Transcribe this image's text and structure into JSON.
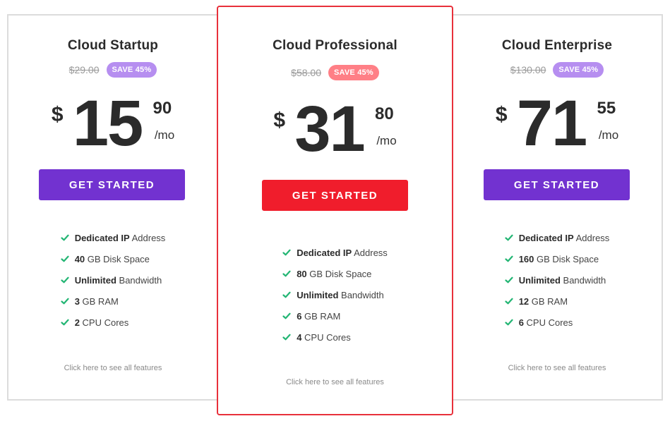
{
  "colors": {
    "purple_button": "#7232d0",
    "red_button": "#f01d2c",
    "featured_border": "#e8303b",
    "check_green": "#22b573",
    "badge_purple": "#b68ef0",
    "badge_red": "#ff7f86"
  },
  "plans": [
    {
      "title": "Cloud Startup",
      "old_price": "$29.00",
      "badge": "SAVE 45%",
      "currency": "$",
      "amount": "15",
      "cents": "90",
      "period": "/mo",
      "cta": "GET STARTED",
      "features": [
        {
          "bold": "Dedicated IP",
          "rest": " Address"
        },
        {
          "bold": "40",
          "rest": " GB Disk Space"
        },
        {
          "bold": "Unlimited",
          "rest": " Bandwidth"
        },
        {
          "bold": "3",
          "rest": " GB RAM"
        },
        {
          "bold": "2",
          "rest": " CPU Cores"
        }
      ],
      "see_all": "Click here to see all features"
    },
    {
      "title": "Cloud Professional",
      "old_price": "$58.00",
      "badge": "SAVE 45%",
      "currency": "$",
      "amount": "31",
      "cents": "80",
      "period": "/mo",
      "cta": "GET STARTED",
      "features": [
        {
          "bold": "Dedicated IP",
          "rest": " Address"
        },
        {
          "bold": "80",
          "rest": " GB Disk Space"
        },
        {
          "bold": "Unlimited",
          "rest": " Bandwidth"
        },
        {
          "bold": "6",
          "rest": " GB RAM"
        },
        {
          "bold": "4",
          "rest": " CPU Cores"
        }
      ],
      "see_all": "Click here to see all features"
    },
    {
      "title": "Cloud Enterprise",
      "old_price": "$130.00",
      "badge": "SAVE 45%",
      "currency": "$",
      "amount": "71",
      "cents": "55",
      "period": "/mo",
      "cta": "GET STARTED",
      "features": [
        {
          "bold": "Dedicated IP",
          "rest": " Address"
        },
        {
          "bold": "160",
          "rest": " GB Disk Space"
        },
        {
          "bold": "Unlimited",
          "rest": " Bandwidth"
        },
        {
          "bold": "12",
          "rest": " GB RAM"
        },
        {
          "bold": "6",
          "rest": " CPU Cores"
        }
      ],
      "see_all": "Click here to see all features"
    }
  ]
}
